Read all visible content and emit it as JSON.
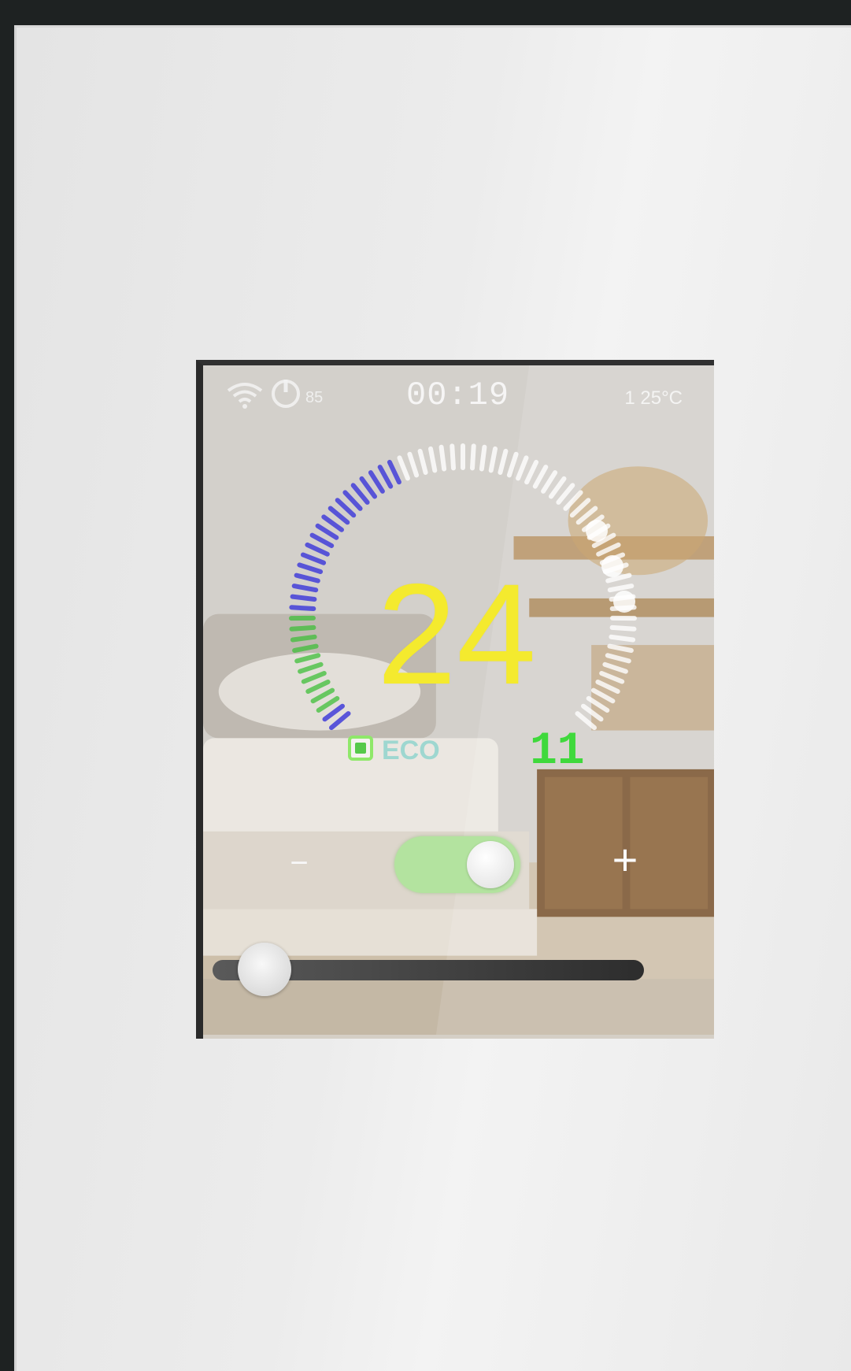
{
  "status_bar": {
    "wifi_icon": "wifi-icon",
    "mode_icon": "power-mode-icon",
    "signal_label": "85",
    "time": "00:19",
    "room_temperature": "1 25°C"
  },
  "thermostat": {
    "setpoint": "24",
    "eco_label": "ECO",
    "humidity": "11",
    "minus_label": "−",
    "plus_label": "+",
    "power_toggle_on": true,
    "slider_level_percent": 12,
    "dial_colors": {
      "cool_arc": "#4b47d9",
      "green_arc": "#3fbf3a",
      "inactive_arc": "#ffffff"
    }
  }
}
